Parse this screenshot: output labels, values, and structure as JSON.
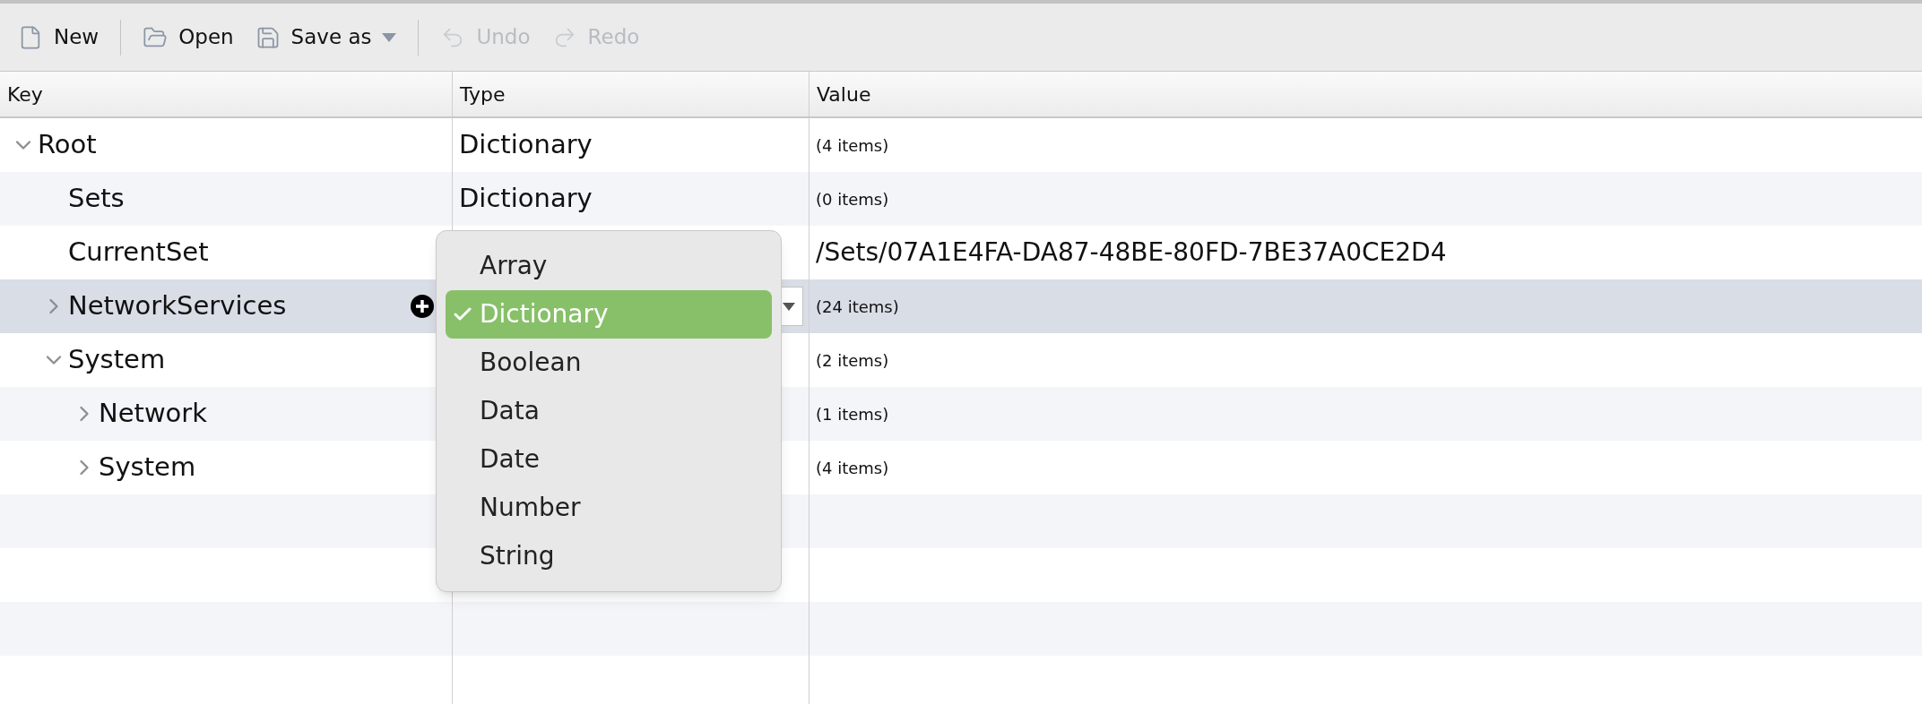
{
  "toolbar": [
    {
      "kind": "new",
      "label": "New",
      "disabled": false
    },
    {
      "kind": "separator"
    },
    {
      "kind": "open",
      "label": "Open",
      "disabled": false
    },
    {
      "kind": "save",
      "label": "Save as",
      "disabled": false
    },
    {
      "kind": "separator"
    },
    {
      "kind": "undo",
      "label": "Undo",
      "disabled": true
    },
    {
      "kind": "redo",
      "label": "Redo",
      "disabled": true
    }
  ],
  "table": {
    "columns": [
      "Key",
      "Type",
      "Value"
    ],
    "rows": [
      {
        "key": "Root",
        "kind": "group",
        "expanded": true,
        "selected": false,
        "type": "Dictionary",
        "value": "(4 items)",
        "children": [
          {
            "key": "Sets",
            "kind": "leaf",
            "selected": false,
            "type": "Dictionary",
            "value": "(0 items)"
          },
          {
            "key": "CurrentSet",
            "kind": "leaf",
            "selected": false,
            "value": "/Sets/07A1E4FA-DA87-48BE-80FD-7BE37A0CE2D4"
          },
          {
            "key": "NetworkServices",
            "kind": "group",
            "expanded": false,
            "selected": true,
            "value": "(24 items)"
          },
          {
            "key": "System",
            "kind": "group",
            "expanded": true,
            "selected": false,
            "value": "(2 items)",
            "children": [
              {
                "key": "Network",
                "kind": "group",
                "expanded": false,
                "selected": false,
                "value": "(1 items)"
              },
              {
                "key": "System",
                "kind": "group",
                "expanded": false,
                "selected": false,
                "value": "(4 items)"
              }
            ]
          }
        ]
      }
    ]
  },
  "type_menu": [
    {
      "label": "Array",
      "selected": false
    },
    {
      "label": "Dictionary",
      "selected": true
    },
    {
      "label": "Boolean",
      "selected": false
    },
    {
      "label": "Data",
      "selected": false
    },
    {
      "label": "Date",
      "selected": false
    },
    {
      "label": "Number",
      "selected": false
    },
    {
      "label": "String",
      "selected": false
    }
  ]
}
